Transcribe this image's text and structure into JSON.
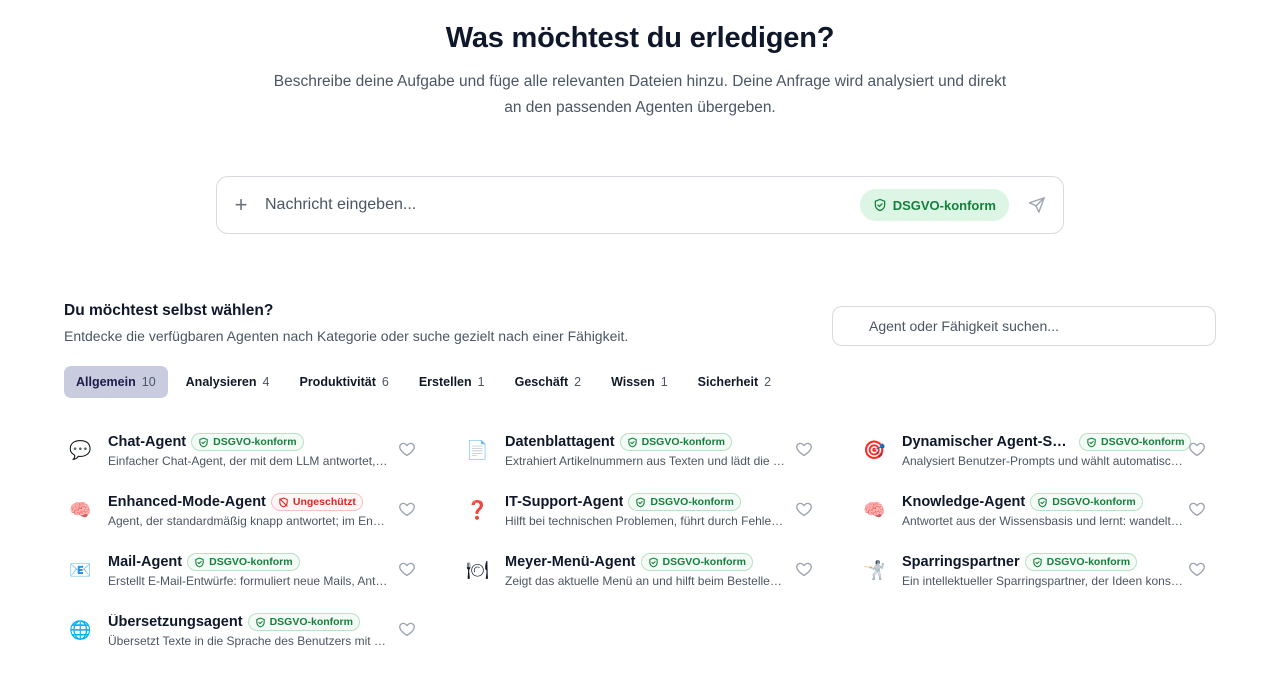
{
  "hero": {
    "title": "Was möchtest du erledigen?",
    "subtitle_line1": "Beschreibe deine Aufgabe und füge alle relevanten Dateien hinzu. Deine Anfrage wird analysiert und direkt",
    "subtitle_line2": "an den passenden Agenten übergeben."
  },
  "composer": {
    "placeholder": "Nachricht eingeben...",
    "badge": "DSGVO-konform"
  },
  "choose": {
    "title": "Du möchtest selbst wählen?",
    "subtitle": "Entdecke die verfügbaren Agenten nach Kategorie oder suche gezielt nach einer Fähigkeit.",
    "search_placeholder": "Agent oder Fähigkeit suchen..."
  },
  "tabs": [
    {
      "label": "Allgemein",
      "count": "10",
      "active": true
    },
    {
      "label": "Analysieren",
      "count": "4"
    },
    {
      "label": "Produktivität",
      "count": "6"
    },
    {
      "label": "Erstellen",
      "count": "1"
    },
    {
      "label": "Geschäft",
      "count": "2"
    },
    {
      "label": "Wissen",
      "count": "1"
    },
    {
      "label": "Sicherheit",
      "count": "2"
    }
  ],
  "agents": [
    {
      "name": "Chat-Agent",
      "badge": "DSGVO-konform",
      "status": "ok",
      "icon": "speech-bubble-icon",
      "glyph": "💬",
      "desc": "Einfacher Chat-Agent, der mit dem LLM antwortet, ohne weitere Tools"
    },
    {
      "name": "Datenblattagent",
      "badge": "DSGVO-konform",
      "status": "ok",
      "icon": "document-icon",
      "glyph": "📄",
      "desc": "Extrahiert Artikelnummern aus Texten und lädt die passenden Datenblätter"
    },
    {
      "name": "Dynamischer Agent-Sele...",
      "badge": "DSGVO-konform",
      "status": "ok",
      "icon": "target-icon",
      "glyph": "🎯",
      "desc": "Analysiert Benutzer-Prompts und wählt automatisch den passenden Agenten"
    },
    {
      "name": "Enhanced-Mode-Agent",
      "badge": "Ungeschützt",
      "status": "bad",
      "icon": "brain-icon",
      "glyph": "🧠",
      "desc": "Agent, der standardmäßig knapp antwortet; im Enhanced-Mode ausführlich"
    },
    {
      "name": "IT-Support-Agent",
      "badge": "DSGVO-konform",
      "status": "ok",
      "icon": "question-mark-icon",
      "glyph": "❓",
      "desc": "Hilft bei technischen Problemen, führt durch Fehlerbehebungen"
    },
    {
      "name": "Knowledge-Agent",
      "badge": "DSGVO-konform",
      "status": "ok",
      "icon": "brain-icon",
      "glyph": "🧠",
      "desc": "Antwortet aus der Wissensbasis und lernt: wandelt neue Informationen"
    },
    {
      "name": "Mail-Agent",
      "badge": "DSGVO-konform",
      "status": "ok",
      "icon": "envelope-icon",
      "glyph": "📧",
      "desc": "Erstellt E-Mail-Entwürfe: formuliert neue Mails, Antworten und Weiterleitungen"
    },
    {
      "name": "Meyer-Menü-Agent",
      "badge": "DSGVO-konform",
      "status": "ok",
      "icon": "plate-cutlery-icon",
      "glyph": "🍽",
      "desc": "Zeigt das aktuelle Menü an und hilft beim Bestellen in der Kantine"
    },
    {
      "name": "Sparringspartner",
      "badge": "DSGVO-konform",
      "status": "ok",
      "icon": "fencer-icon",
      "glyph": "🤺",
      "desc": "Ein intellektueller Sparringspartner, der Ideen konstruktiv hinterfragt"
    },
    {
      "name": "Übersetzungsagent",
      "badge": "DSGVO-konform",
      "status": "ok",
      "icon": "globe-icon",
      "glyph": "🌐",
      "desc": "Übersetzt Texte in die Sprache des Benutzers mit Genauigkeit und Stil"
    }
  ],
  "colors": {
    "ok": "#15803d",
    "bad": "#dc2626",
    "active_tab": "#c9cbdf"
  }
}
